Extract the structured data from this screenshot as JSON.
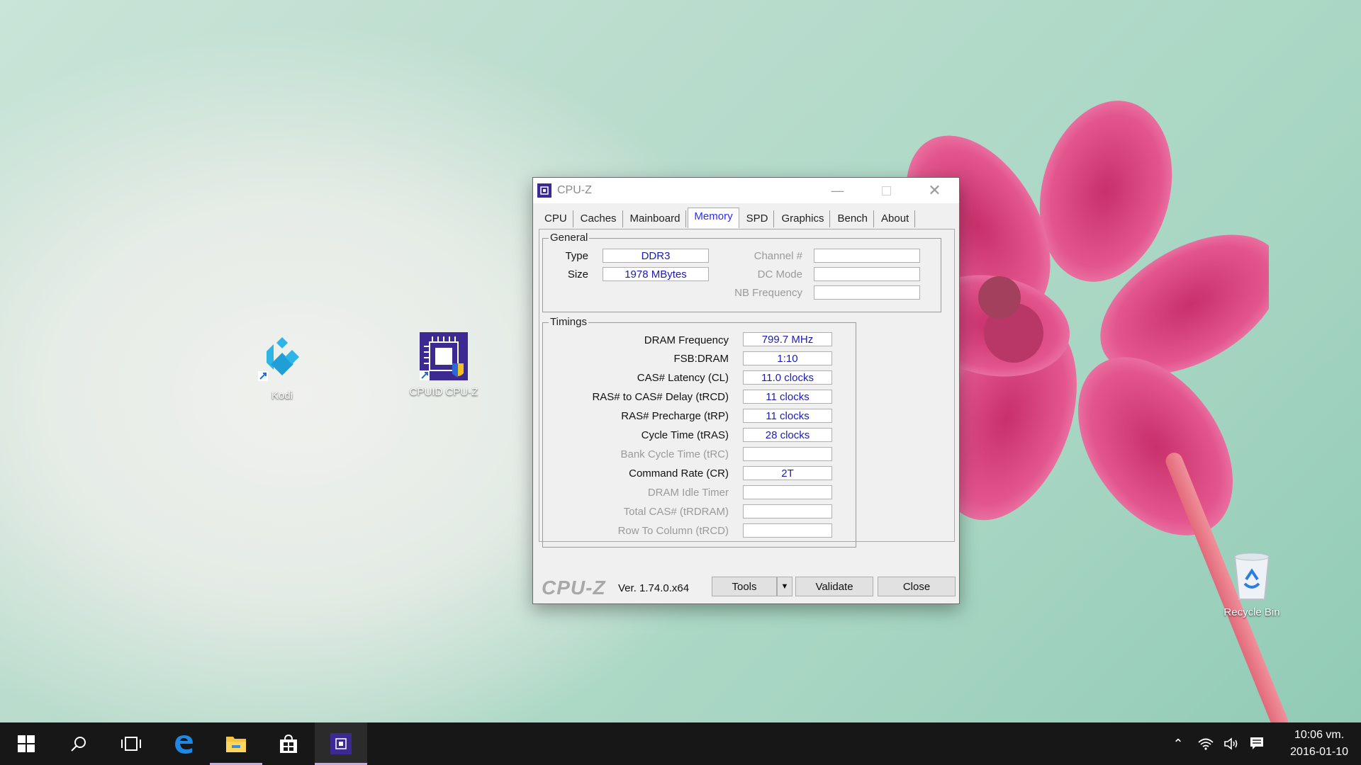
{
  "desktop": {
    "icons": [
      {
        "label": "Kodi"
      },
      {
        "label": "CPUID CPU-Z"
      },
      {
        "label": "Recycle Bin"
      }
    ]
  },
  "window": {
    "title": "CPU-Z",
    "tabs": [
      "CPU",
      "Caches",
      "Mainboard",
      "Memory",
      "SPD",
      "Graphics",
      "Bench",
      "About"
    ],
    "active_tab": "Memory",
    "general": {
      "title": "General",
      "type_label": "Type",
      "type_value": "DDR3",
      "size_label": "Size",
      "size_value": "1978 MBytes",
      "channel_label": "Channel #",
      "channel_value": "",
      "dcmode_label": "DC Mode",
      "dcmode_value": "",
      "nbfreq_label": "NB Frequency",
      "nbfreq_value": ""
    },
    "timings": {
      "title": "Timings",
      "rows": [
        {
          "label": "DRAM Frequency",
          "value": "799.7 MHz",
          "enabled": true
        },
        {
          "label": "FSB:DRAM",
          "value": "1:10",
          "enabled": true
        },
        {
          "label": "CAS# Latency (CL)",
          "value": "11.0 clocks",
          "enabled": true
        },
        {
          "label": "RAS# to CAS# Delay (tRCD)",
          "value": "11 clocks",
          "enabled": true
        },
        {
          "label": "RAS# Precharge (tRP)",
          "value": "11 clocks",
          "enabled": true
        },
        {
          "label": "Cycle Time (tRAS)",
          "value": "28 clocks",
          "enabled": true
        },
        {
          "label": "Bank Cycle Time (tRC)",
          "value": "",
          "enabled": false
        },
        {
          "label": "Command Rate (CR)",
          "value": "2T",
          "enabled": true
        },
        {
          "label": "DRAM Idle Timer",
          "value": "",
          "enabled": false
        },
        {
          "label": "Total CAS# (tRDRAM)",
          "value": "",
          "enabled": false
        },
        {
          "label": "Row To Column (tRCD)",
          "value": "",
          "enabled": false
        }
      ]
    },
    "footer": {
      "logo": "CPU-Z",
      "version": "Ver. 1.74.0.x64",
      "tools_label": "Tools",
      "validate_label": "Validate",
      "close_label": "Close"
    }
  },
  "taskbar": {
    "time": "10:06 vm.",
    "date": "2016-01-10"
  }
}
